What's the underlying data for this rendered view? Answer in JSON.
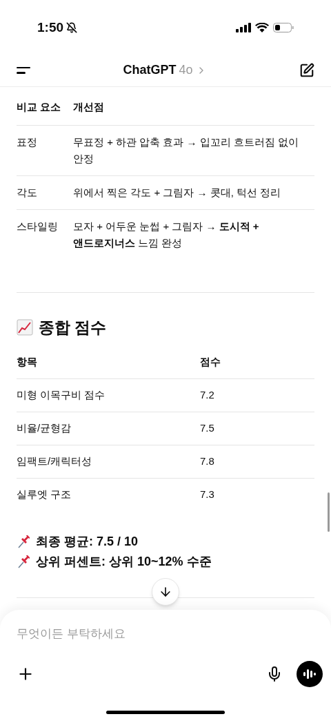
{
  "status_bar": {
    "time": "1:50"
  },
  "header": {
    "title": "ChatGPT",
    "model": "4o"
  },
  "comparison_table": {
    "columns": [
      "비교 요소",
      "개선점"
    ],
    "rows": [
      {
        "element": "표정",
        "improvement": "무표정 + 하관 압축 효과 → 입꼬리 흐트러짐 없이 안정"
      },
      {
        "element": "각도",
        "improvement": "위에서 찍은 각도 + 그림자 → 콧대, 턱선 정리"
      },
      {
        "element": "스타일링",
        "improvement": "모자 + 어두운 눈썹 + 그림자 → **도시적 + 앤드로지너스** 느낌 완성"
      }
    ]
  },
  "score_section": {
    "heading": "종합 점수",
    "columns": [
      "항목",
      "점수"
    ],
    "rows": [
      {
        "item": "미형 이목구비 점수",
        "score": "7.2"
      },
      {
        "item": "비율/균형감",
        "score": "7.5"
      },
      {
        "item": "임팩트/캐릭터성",
        "score": "7.8"
      },
      {
        "item": "실루엣 구조",
        "score": "7.3"
      }
    ]
  },
  "summary": [
    {
      "text": "최종 평균: 7.5 / 10"
    },
    {
      "text": "상위 퍼센트: 상위 10~12% 수준"
    }
  ],
  "composer": {
    "placeholder": "무엇이든 부탁하세요"
  }
}
